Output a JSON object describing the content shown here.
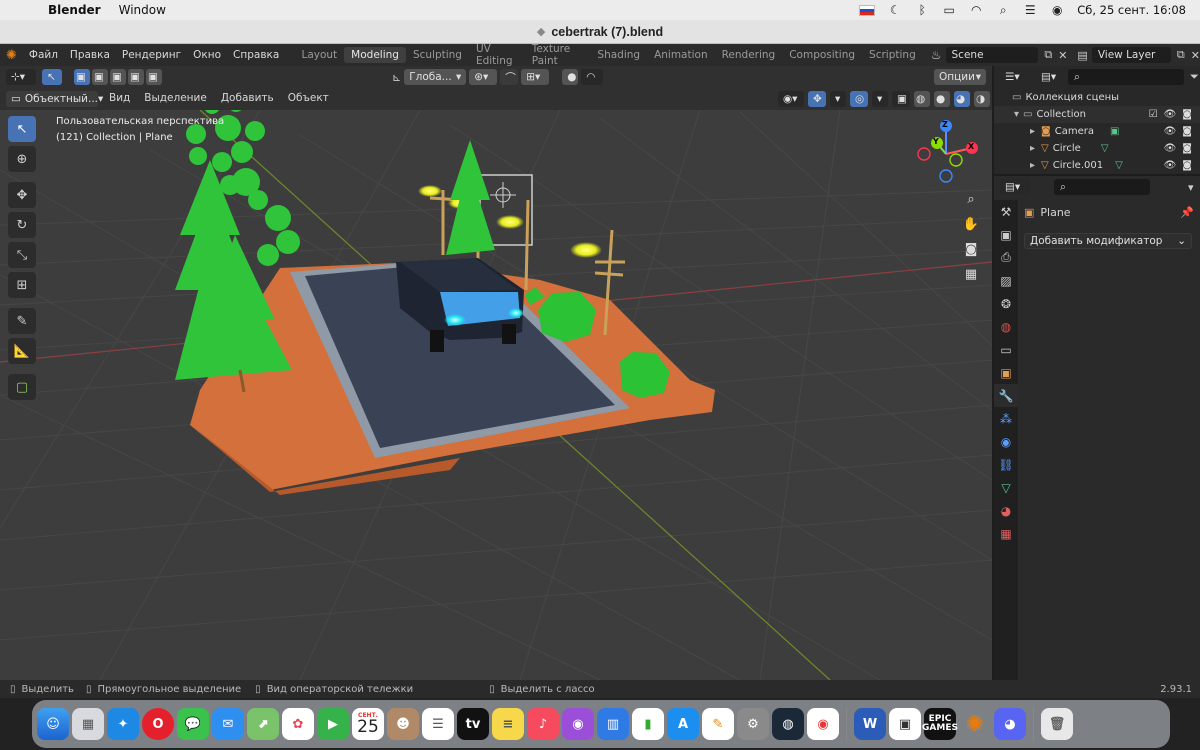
{
  "macos_menubar": {
    "app_name": "Blender",
    "menu": [
      "Window"
    ],
    "clock": "Сб, 25 сент.  16:08"
  },
  "window": {
    "title": "cebertrak (7).blend"
  },
  "blender_menu": [
    "Файл",
    "Правка",
    "Рендеринг",
    "Окно",
    "Справка"
  ],
  "workspaces": [
    {
      "label": "Layout",
      "active": false
    },
    {
      "label": "Modeling",
      "active": true
    },
    {
      "label": "Sculpting",
      "active": false
    },
    {
      "label": "UV Editing",
      "active": false
    },
    {
      "label": "Texture Paint",
      "active": false
    },
    {
      "label": "Shading",
      "active": false
    },
    {
      "label": "Animation",
      "active": false
    },
    {
      "label": "Rendering",
      "active": false
    },
    {
      "label": "Compositing",
      "active": false
    },
    {
      "label": "Scripting",
      "active": false
    }
  ],
  "scene_field": "Scene",
  "view_layer_field": "View Layer",
  "tool_header": {
    "transform_orientation": "Глоба...",
    "options": "Опции"
  },
  "viewport_header": {
    "mode": "Объектный...",
    "menus": [
      "Вид",
      "Выделение",
      "Добавить",
      "Объект"
    ]
  },
  "viewport_overlay": {
    "view_name": "Пользовательская перспектива",
    "collection_info": "(121) Collection | Plane"
  },
  "gizmo": {
    "x": "X",
    "y": "Y",
    "z": "Z"
  },
  "outliner": {
    "root": "Коллекция сцены",
    "collection": "Collection",
    "items": [
      "Camera",
      "Circle",
      "Circle.001"
    ]
  },
  "properties": {
    "object_name": "Plane",
    "add_modifier": "Добавить модификатор"
  },
  "statusbar": {
    "select": "Выделить",
    "box_select": "Прямоугольное выделение",
    "dolly_view": "Вид операторской тележки",
    "lasso_select": "Выделить с лассо",
    "version": "2.93.1"
  },
  "dock": {
    "calendar_month": "СЕНТ.",
    "calendar_day": "25",
    "epic_label": "EPIC GAMES"
  },
  "colors": {
    "accent_blue": "#4772b3",
    "grass_orange": "#d3703b",
    "road": "#3a4256",
    "tree_green": "#2fc43a"
  }
}
